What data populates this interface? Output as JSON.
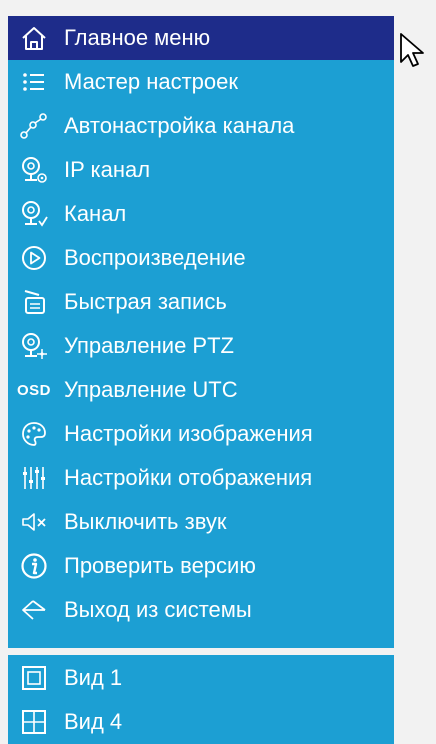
{
  "menu": {
    "items": [
      {
        "icon": "home-icon",
        "label": "Главное меню"
      },
      {
        "icon": "list-icon",
        "label": "Мастер настроек"
      },
      {
        "icon": "auto-channel-icon",
        "label": "Автонастройка канала"
      },
      {
        "icon": "ip-camera-icon",
        "label": "IP канал"
      },
      {
        "icon": "camera-check-icon",
        "label": "Канал"
      },
      {
        "icon": "play-circle-icon",
        "label": "Воспроизведение"
      },
      {
        "icon": "quick-record-icon",
        "label": "Быстрая запись"
      },
      {
        "icon": "ptz-camera-icon",
        "label": "Управление PTZ"
      },
      {
        "icon": "osd-icon",
        "icon_text": "OSD",
        "label": "Управление UTC"
      },
      {
        "icon": "palette-icon",
        "label": "Настройки изображения"
      },
      {
        "icon": "equalizer-icon",
        "label": "Настройки отображения"
      },
      {
        "icon": "mute-icon",
        "label": "Выключить звук"
      },
      {
        "icon": "info-icon",
        "label": "Проверить версию"
      },
      {
        "icon": "logout-icon",
        "label": "Выход из системы"
      }
    ],
    "view_items": [
      {
        "icon": "single-view-icon",
        "label": "Вид 1"
      },
      {
        "icon": "quad-view-icon",
        "label": "Вид 4"
      }
    ]
  },
  "colors": {
    "menu_bg": "#1c9fd3",
    "active_bg": "#1e2c8a",
    "text": "#ffffff"
  }
}
